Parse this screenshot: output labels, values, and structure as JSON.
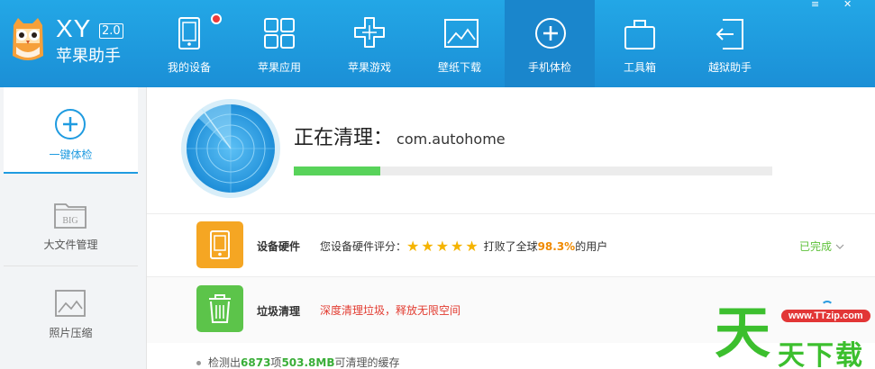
{
  "brand": {
    "name_latin": "XY",
    "version": "2.0",
    "name_cn": "苹果助手"
  },
  "window_controls": {
    "menu": "≡",
    "close": "✕"
  },
  "nav": [
    {
      "label": "我的设备",
      "icon": "phone-icon",
      "badge": true
    },
    {
      "label": "苹果应用",
      "icon": "apps-grid-icon"
    },
    {
      "label": "苹果游戏",
      "icon": "gamepad-icon"
    },
    {
      "label": "壁纸下载",
      "icon": "wallpaper-icon"
    },
    {
      "label": "手机体检",
      "icon": "checkup-plus-icon",
      "active": true
    },
    {
      "label": "工具箱",
      "icon": "toolbox-icon"
    },
    {
      "label": "越狱助手",
      "icon": "jailbreak-icon"
    }
  ],
  "sidebar": {
    "items": [
      {
        "label": "一键体检",
        "icon": "checkup-plus-icon",
        "active": true
      },
      {
        "label": "大文件管理",
        "icon": "big-file-icon"
      },
      {
        "label": "照片压缩",
        "icon": "photo-icon"
      }
    ]
  },
  "scan": {
    "title": "正在清理：",
    "package": "com.autohome",
    "progress": 0.18
  },
  "rows": {
    "hardware": {
      "label": "设备硬件",
      "desc_prefix": "您设备硬件评分：",
      "stars": "★★★★★",
      "desc_mid": "打败了全球",
      "percent": "98.3%",
      "desc_suffix": "的用户",
      "status": "已完成",
      "color": "#f5a623"
    },
    "junk": {
      "label": "垃圾清理",
      "desc": "深度清理垃圾，释放无限空间",
      "color": "#5cc44a"
    }
  },
  "summary": {
    "prefix": "检测出",
    "count": "6873",
    "unit1": "项",
    "size": "503.8MB",
    "suffix": "可清理的缓存"
  },
  "watermark": {
    "url": "www.TTzip.com",
    "big": "天",
    "small": "天下载"
  },
  "colors": {
    "header": "#1f9be0",
    "accent": "#1f9be0",
    "progress": "#58d35a",
    "warning": "#e23b30"
  }
}
